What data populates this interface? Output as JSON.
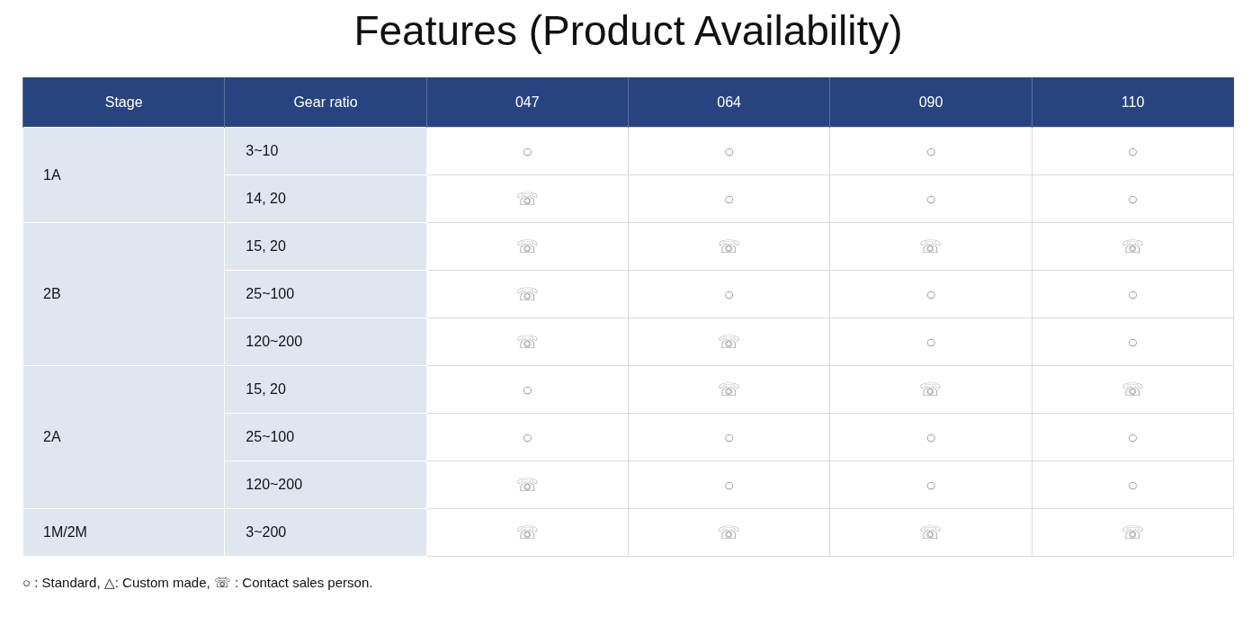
{
  "title": "Features (Product Availability)",
  "table": {
    "columns": [
      "Stage",
      "Gear ratio",
      "047",
      "064",
      "090",
      "110"
    ],
    "groups": [
      {
        "stage": "1A",
        "rows": [
          {
            "ratio": "3~10",
            "cells": [
              "○",
              "○",
              "○",
              "○"
            ]
          },
          {
            "ratio": "14, 20",
            "cells": [
              "☏",
              "○",
              "○",
              "○"
            ]
          }
        ]
      },
      {
        "stage": "2B",
        "rows": [
          {
            "ratio": "15, 20",
            "cells": [
              "☏",
              "☏",
              "☏",
              "☏"
            ]
          },
          {
            "ratio": "25~100",
            "cells": [
              "☏",
              "○",
              "○",
              "○"
            ]
          },
          {
            "ratio": "120~200",
            "cells": [
              "☏",
              "☏",
              "○",
              "○"
            ]
          }
        ]
      },
      {
        "stage": "2A",
        "rows": [
          {
            "ratio": "15, 20",
            "cells": [
              "○",
              "☏",
              "☏",
              "☏"
            ]
          },
          {
            "ratio": "25~100",
            "cells": [
              "○",
              "○",
              "○",
              "○"
            ]
          },
          {
            "ratio": "120~200",
            "cells": [
              "☏",
              "○",
              "○",
              "○"
            ]
          }
        ]
      },
      {
        "stage": "1M/2M",
        "rows": [
          {
            "ratio": "3~200",
            "cells": [
              "☏",
              "☏",
              "☏",
              "☏"
            ]
          }
        ]
      }
    ]
  },
  "legend": "○ : Standard, △: Custom made, ☏ : Contact sales person."
}
